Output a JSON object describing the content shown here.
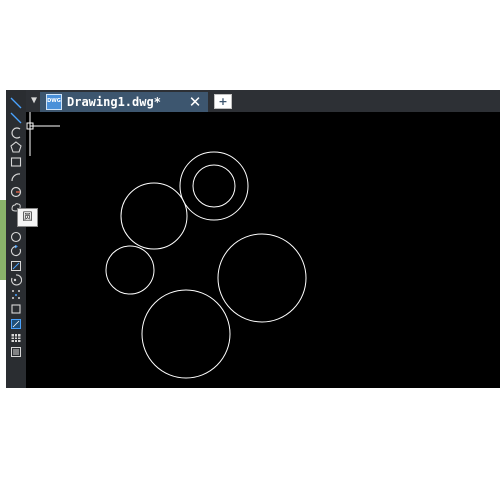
{
  "tabs": [
    {
      "title": "Drawing1.dwg*",
      "active": true
    }
  ],
  "tab_close_label": "✕",
  "new_tab_label": "+",
  "tooltip_text": "圆",
  "tab_menu_arrow": "▼",
  "toolbar_tools": [
    "line-icon",
    "polyline-icon",
    "arc-edit-icon",
    "polygon-icon",
    "rectangle-icon",
    "arc-icon",
    "circle-draw-icon",
    "revision-cloud-icon",
    "spline-icon",
    "ellipse-icon",
    "ellipse-arc-icon",
    "insert-block-icon",
    "create-block-icon",
    "point-icon",
    "hatch-icon",
    "gradient-icon",
    "region-icon",
    "table-icon",
    "multiline-text-icon"
  ],
  "colors": {
    "canvas": "#000000",
    "entity": "#ffffff",
    "tab_active": "#3d566f",
    "ui_dark": "#2c2f33"
  }
}
